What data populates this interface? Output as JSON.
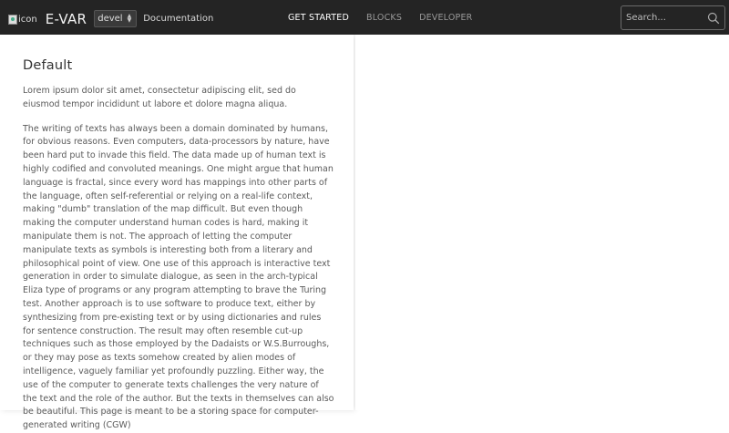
{
  "navbar": {
    "logo_alt": "icon",
    "brand": "E-VAR",
    "version_selected": "devel",
    "docs_link": "Documentation",
    "items": [
      {
        "label": "GET STARTED",
        "active": true
      },
      {
        "label": "BLOCKS",
        "active": false
      },
      {
        "label": "DEVELOPER",
        "active": false
      }
    ],
    "search_placeholder": "Search..."
  },
  "content": {
    "title": "Default",
    "paragraph1": "Lorem ipsum dolor sit amet, consectetur adipiscing elit, sed do eiusmod tempor incididunt ut labore et dolore magna aliqua.",
    "paragraph2": "The writing of texts has always been a domain dominated by humans, for obvious reasons. Even computers, data-processors by nature, have been hard put to invade this field. The data made up of human text is highly codified and convoluted meanings. One might argue that human language is fractal, since every word has mappings into other parts of the language, often self-referential or relying on a real-life context, making \"dumb\" translation of the map difficult. But even though making the computer understand human codes is hard, making it manipulate them is not. The approach of letting the computer manipulate texts as symbols is interesting both from a literary and philosophical point of view. One use of this approach is interactive text generation in order to simulate dialogue, as seen in the arch-typical Eliza type of programs or any program attempting to brave the Turing test. Another approach is to use software to produce text, either by synthesizing from pre-existing text or by using dictionaries and rules for sentence construction. The result may often resemble cut-up techniques such as those employed by the Dadaists or W.S.Burroughs, or they may pose as texts somehow created by alien modes of intelligence, vaguely familiar yet profoundly puzzling. Either way, the use of the computer to generate texts challenges the very nature of the text and the role of the author. But the texts in themselves can also be beautiful. This page is meant to be a storing space for computer-generated writing (CGW)"
  }
}
